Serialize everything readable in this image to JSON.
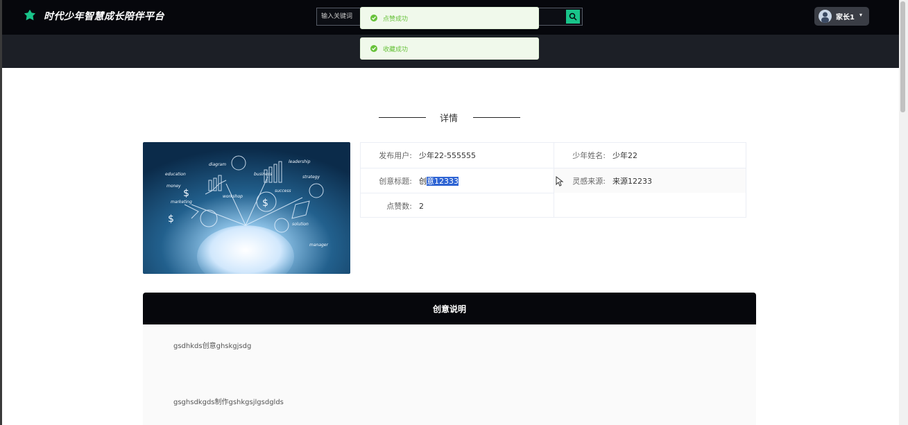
{
  "header": {
    "site_title": "时代少年智慧成长陪伴平台",
    "search_placeholder": "输入关键词",
    "user_name": "家长1",
    "accent_color": "#19c48a"
  },
  "toasts": [
    {
      "text": "点赞成功"
    },
    {
      "text": "收藏成功"
    }
  ],
  "detail": {
    "heading": "详情",
    "fields": {
      "publisher_label": "发布用户:",
      "publisher_value": "少年22-555555",
      "student_name_label": "少年姓名:",
      "student_name_value": "少年22",
      "title_label": "创意标题:",
      "title_value_pre": "创",
      "title_value_selected": "意12333",
      "inspiration_label": "灵感来源:",
      "inspiration_value": "来源12233",
      "likes_label": "点赞数:",
      "likes_value": "2"
    },
    "image_words": [
      "education",
      "money",
      "success",
      "business",
      "marketing",
      "strategy",
      "diagram",
      "leadership",
      "workshop",
      "solution",
      "manager"
    ]
  },
  "description": {
    "title": "创意说明",
    "lines": [
      "gsdhkds创意ghskgjsdg",
      "gsghsdkgds制作gshkgsjlgsdglds"
    ]
  }
}
